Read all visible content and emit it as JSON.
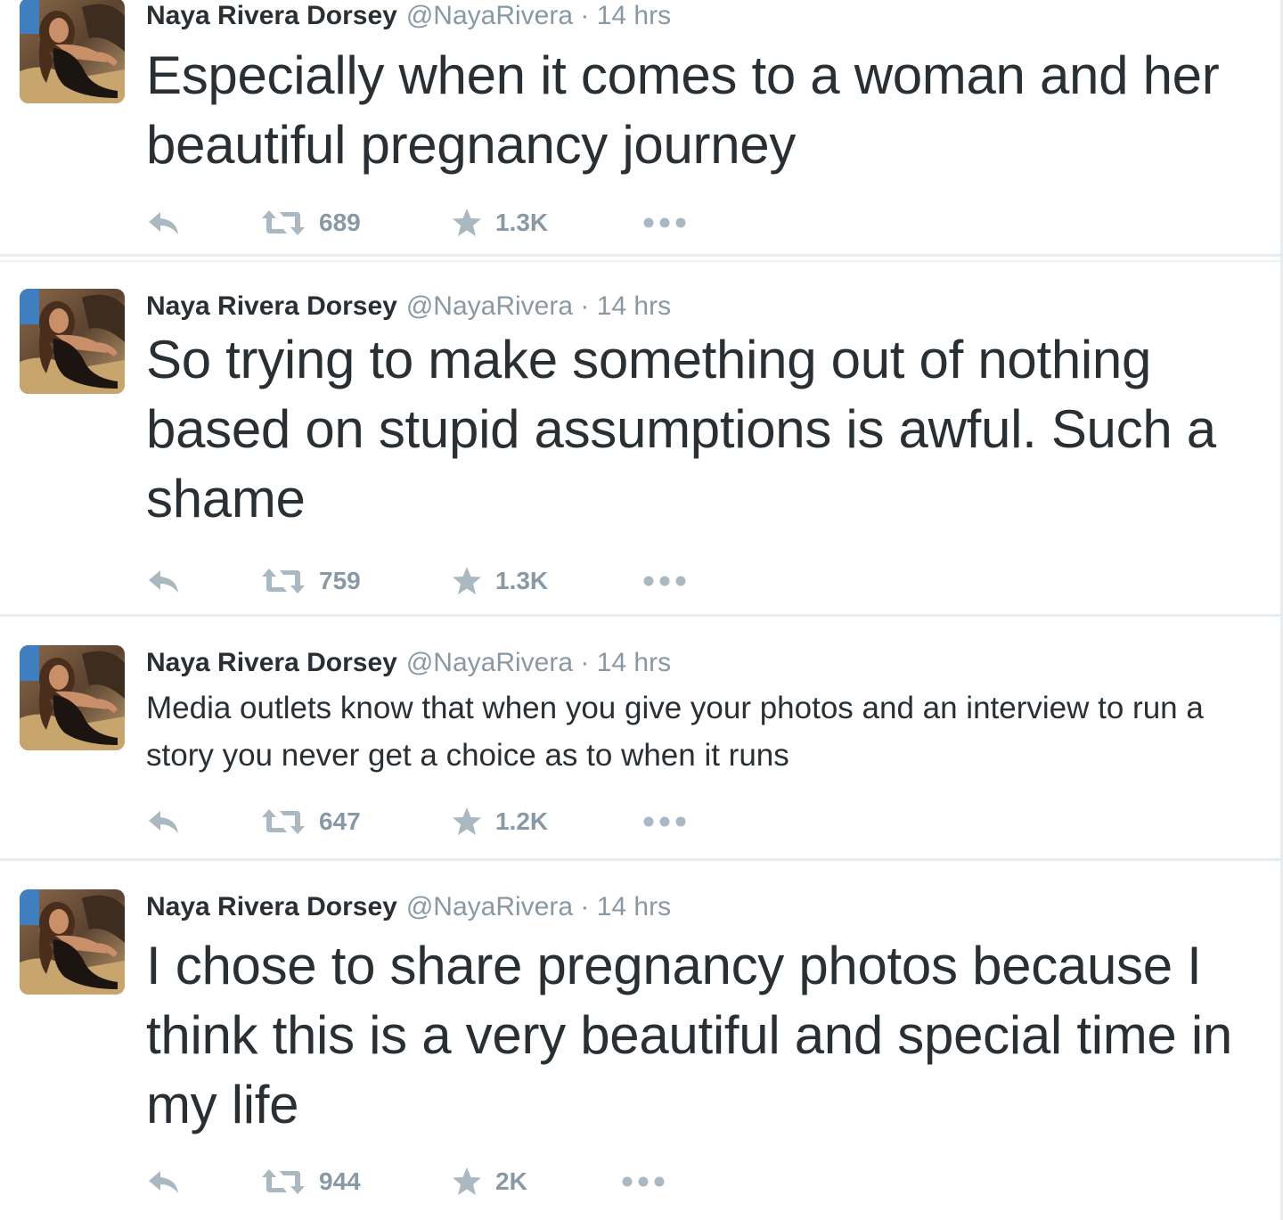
{
  "colors": {
    "text": "#292f33",
    "meta": "#8899a6",
    "icon": "#aab8c2",
    "divider": "#e6ecf0"
  },
  "icons": {
    "reply": "reply-icon",
    "retweet": "retweet-icon",
    "favorite": "star-icon",
    "more": "more-dots-icon"
  },
  "tweets": [
    {
      "fullname": "Naya Rivera Dorsey",
      "username": "@NayaRivera",
      "separator": "·",
      "time": "14 hrs",
      "text": "Especially when it comes to a woman and her beautiful pregnancy journey",
      "retweets": "689",
      "favorites": "1.3K"
    },
    {
      "fullname": "Naya Rivera Dorsey",
      "username": "@NayaRivera",
      "separator": "·",
      "time": "14 hrs",
      "text": "So trying to make something out of nothing based on stupid assumptions is awful. Such a shame",
      "retweets": "759",
      "favorites": "1.3K"
    },
    {
      "fullname": "Naya Rivera Dorsey",
      "username": "@NayaRivera",
      "separator": "·",
      "time": "14 hrs",
      "text": "Media outlets know that when you give your photos and an interview to run a story you never get a choice as to when it runs",
      "retweets": "647",
      "favorites": "1.2K"
    },
    {
      "fullname": "Naya Rivera Dorsey",
      "username": "@NayaRivera",
      "separator": "·",
      "time": "14 hrs",
      "text": "I chose to share pregnancy photos because I think this is a very beautiful and special time in my life",
      "retweets": "944",
      "favorites": "2K"
    }
  ]
}
